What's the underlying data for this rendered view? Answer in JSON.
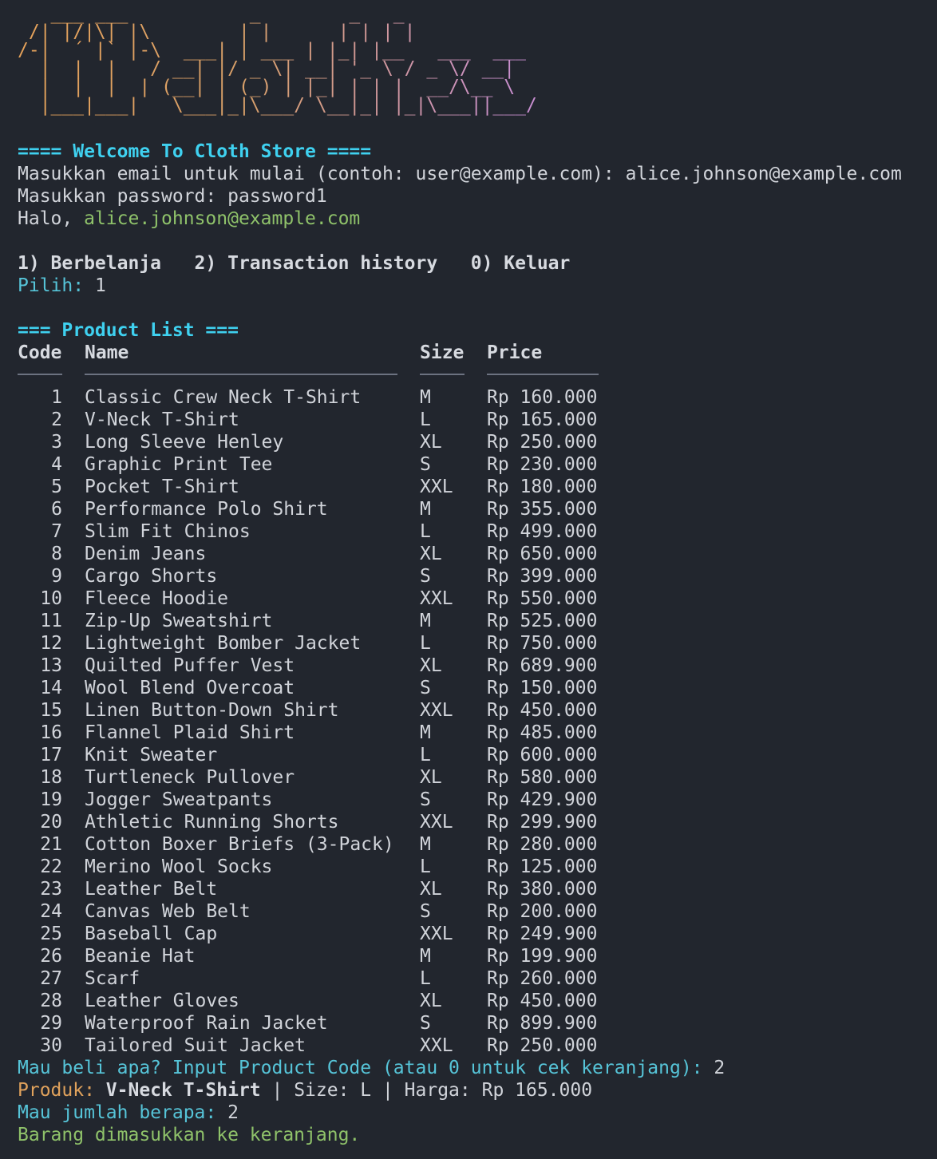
{
  "ascii_logo": "   ___ ___           _        _   _\n /| |/|\\| |\\        | |      | | | |\n/-|  ´ |` |-\\  ___| | ___ | |_| |__   ___  ___\n  |  |  |   / __| |/ _ \\| __| '_ \\ / _ \\/ __|\n  |  |  |  | (__| | (_) | |_| | | |  __/\\__ \\\n  |___|___|   \\___|_|\\___/ \\__|_| |_|\\___||___/",
  "welcome_banner": "==== Welcome To Cloth Store ====",
  "email_prompt": "Masukkan email untuk mulai (contoh: user@example.com): ",
  "email_value": "alice.johnson@example.com",
  "password_prompt": "Masukkan password: ",
  "password_value": "password1",
  "greeting_prefix": "Halo, ",
  "greeting_user": "alice.johnson@example.com",
  "menu_line": "1) Berbelanja   2) Transaction history   0) Keluar",
  "choice_prompt": "Pilih: ",
  "choice_value": "1",
  "product_list_title": "=== Product List ===",
  "table": {
    "headers": {
      "code": "Code",
      "name": "Name",
      "size": "Size",
      "price": "Price"
    },
    "rows": [
      {
        "code": "1",
        "name": "Classic Crew Neck T-Shirt",
        "size": "M",
        "price": "Rp 160.000"
      },
      {
        "code": "2",
        "name": "V-Neck T-Shirt",
        "size": "L",
        "price": "Rp 165.000"
      },
      {
        "code": "3",
        "name": "Long Sleeve Henley",
        "size": "XL",
        "price": "Rp 250.000"
      },
      {
        "code": "4",
        "name": "Graphic Print Tee",
        "size": "S",
        "price": "Rp 230.000"
      },
      {
        "code": "5",
        "name": "Pocket T-Shirt",
        "size": "XXL",
        "price": "Rp 180.000"
      },
      {
        "code": "6",
        "name": "Performance Polo Shirt",
        "size": "M",
        "price": "Rp 355.000"
      },
      {
        "code": "7",
        "name": "Slim Fit Chinos",
        "size": "L",
        "price": "Rp 499.000"
      },
      {
        "code": "8",
        "name": "Denim Jeans",
        "size": "XL",
        "price": "Rp 650.000"
      },
      {
        "code": "9",
        "name": "Cargo Shorts",
        "size": "S",
        "price": "Rp 399.000"
      },
      {
        "code": "10",
        "name": "Fleece Hoodie",
        "size": "XXL",
        "price": "Rp 550.000"
      },
      {
        "code": "11",
        "name": "Zip-Up Sweatshirt",
        "size": "M",
        "price": "Rp 525.000"
      },
      {
        "code": "12",
        "name": "Lightweight Bomber Jacket",
        "size": "L",
        "price": "Rp 750.000"
      },
      {
        "code": "13",
        "name": "Quilted Puffer Vest",
        "size": "XL",
        "price": "Rp 689.900"
      },
      {
        "code": "14",
        "name": "Wool Blend Overcoat",
        "size": "S",
        "price": "Rp 150.000"
      },
      {
        "code": "15",
        "name": "Linen Button-Down Shirt",
        "size": "XXL",
        "price": "Rp 450.000"
      },
      {
        "code": "16",
        "name": "Flannel Plaid Shirt",
        "size": "M",
        "price": "Rp 485.000"
      },
      {
        "code": "17",
        "name": "Knit Sweater",
        "size": "L",
        "price": "Rp 600.000"
      },
      {
        "code": "18",
        "name": "Turtleneck Pullover",
        "size": "XL",
        "price": "Rp 580.000"
      },
      {
        "code": "19",
        "name": "Jogger Sweatpants",
        "size": "S",
        "price": "Rp 429.900"
      },
      {
        "code": "20",
        "name": "Athletic Running Shorts",
        "size": "XXL",
        "price": "Rp 299.900"
      },
      {
        "code": "21",
        "name": "Cotton Boxer Briefs (3-Pack)",
        "size": "M",
        "price": "Rp 280.000"
      },
      {
        "code": "22",
        "name": "Merino Wool Socks",
        "size": "L",
        "price": "Rp 125.000"
      },
      {
        "code": "23",
        "name": "Leather Belt",
        "size": "XL",
        "price": "Rp 380.000"
      },
      {
        "code": "24",
        "name": "Canvas Web Belt",
        "size": "S",
        "price": "Rp 200.000"
      },
      {
        "code": "25",
        "name": "Baseball Cap",
        "size": "XXL",
        "price": "Rp 249.900"
      },
      {
        "code": "26",
        "name": "Beanie Hat",
        "size": "M",
        "price": "Rp 199.900"
      },
      {
        "code": "27",
        "name": "Scarf",
        "size": "L",
        "price": "Rp 260.000"
      },
      {
        "code": "28",
        "name": "Leather Gloves",
        "size": "XL",
        "price": "Rp 450.000"
      },
      {
        "code": "29",
        "name": "Waterproof Rain Jacket",
        "size": "S",
        "price": "Rp 899.900"
      },
      {
        "code": "30",
        "name": "Tailored Suit Jacket",
        "size": "XXL",
        "price": "Rp 250.000"
      }
    ]
  },
  "buy_prompt": "Mau beli apa? Input Product Code (atau 0 untuk cek keranjang): ",
  "buy_value": "2",
  "product_label": "Produk: ",
  "product_name": "V-Neck T-Shirt",
  "product_details": " | Size: L | Harga: Rp 165.000",
  "qty_prompt": "Mau jumlah berapa: ",
  "qty_value": "2",
  "cart_message": "Barang dimasukkan ke keranjang.",
  "colors": {
    "background": "#22262e",
    "cyan": "#56c4d8",
    "green": "#8fc26a",
    "orange": "#e0a25c"
  }
}
